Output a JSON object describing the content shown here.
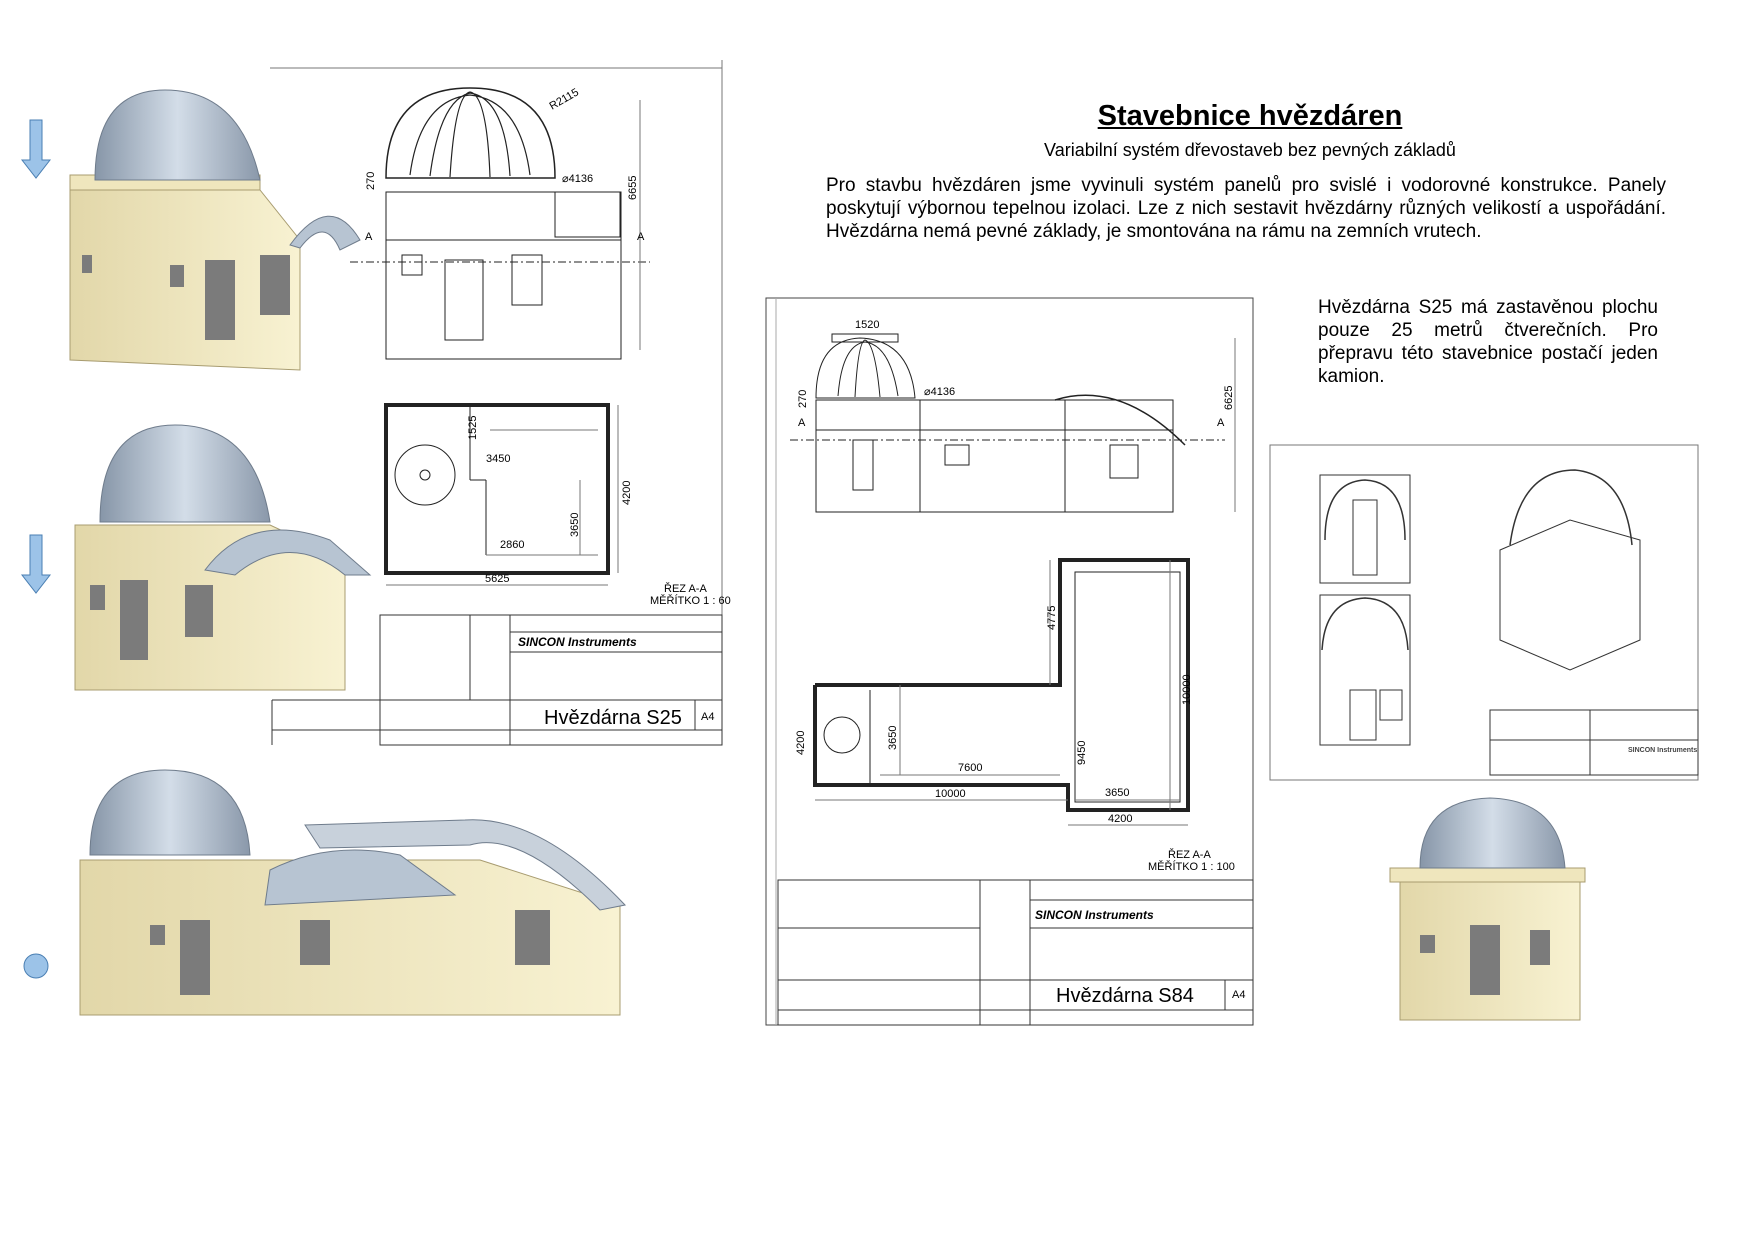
{
  "header": {
    "title": "Stavebnice hvězdáren",
    "subtitle": "Variabilní systém dřevostaveb bez pevných základů"
  },
  "intro_text": "Pro stavbu hvězdáren jsme vyvinuli systém  panelů pro svislé i vodorovné konstrukce. Panely poskytují výbornou tepelnou izolaci. Lze z nich sestavit hvězdárny různých velikostí a uspořádání. Hvězdárna nemá pevné základy, je smontována na rámu na zemních vrutech.",
  "s25_text": "Hvězdárna S25 má zastavěnou plochu pouze 25 metrů čtverečních. Pro přepravu této stavebnice postačí jeden kamion.",
  "drawing_s25": {
    "company": "SINCON Instruments",
    "name": "Hvězdárna S25",
    "sheet": "A4",
    "section_label": "ŘEZ A-A",
    "scale": "MĚŘÍTKO 1 : 60",
    "dims": {
      "radius": "R2115",
      "dome": "⌀4136",
      "h270": "270",
      "h6655": "6655",
      "w1525": "1525",
      "w3450": "3450",
      "w2860": "2860",
      "h3650": "3650",
      "h4200": "4200",
      "w5625": "5625"
    },
    "section_mark": "A"
  },
  "drawing_s84": {
    "company": "SINCON Instruments",
    "name": "Hvězdárna S84",
    "sheet": "A4",
    "section_label": "ŘEZ A-A",
    "scale": "MĚŘÍTKO 1 : 100",
    "dims": {
      "w1520": "1520",
      "dome": "⌀4136",
      "h270": "270",
      "h6625": "6625",
      "h4775": "4775",
      "h10000v": "10000",
      "h4200": "4200",
      "h3650": "3650",
      "w7600": "7600",
      "h9450": "9450",
      "w3650": "3650",
      "w10000": "10000",
      "w4200": "4200"
    },
    "section_mark": "A"
  },
  "drawing_small": {
    "company": "SINCON Instruments"
  },
  "icons": [
    "down-arrow-icon",
    "down-arrow-icon",
    "circle-bullet-icon"
  ],
  "colors": {
    "panel": "#f3ecc6",
    "dome": "#aebccc",
    "arrow": "#9cc3e8"
  }
}
